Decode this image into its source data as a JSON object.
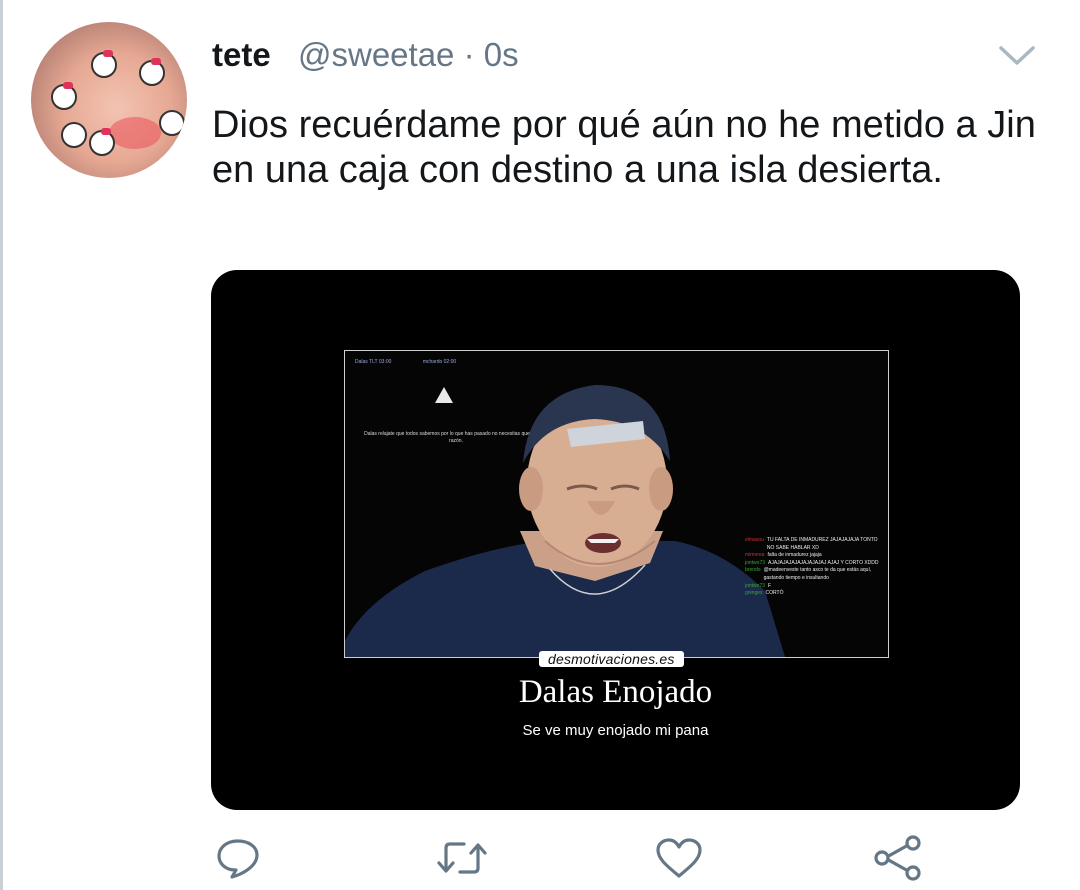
{
  "tweet": {
    "author_name": "tete",
    "handle_time": "@sweetae · 0s",
    "text": "Dios recuérdame por qué aún no he metido a Jin en una caja con destino a una isla desierta."
  },
  "media": {
    "scoreboard": [
      "Dalas TLT 03:00",
      "mchardo 02:00"
    ],
    "overlay_message": "Dalas relajate que todos sabemos por lo que has pasado no necesitas que él entre razón.",
    "chat": [
      {
        "user": "elmasnu",
        "text": "TU FALTA DE INMADUREZ JAJAJAJAJA TONTO NO SABE HABLAR XD"
      },
      {
        "user": "mimorea",
        "text": "falta de inmadurez jajaja"
      },
      {
        "user": "jontwo73",
        "text": "AJAJAJAJAJAJAJAJAJAJ AJAJ Y CORTO XDDD"
      },
      {
        "user": "brendo",
        "text": "@madeenveste tanto asco te da que estás aquí, gastando tiempo e insultando"
      },
      {
        "user": "jontwo73",
        "text": "F"
      },
      {
        "user": "goinges",
        "text": "CORTÓ"
      }
    ],
    "watermark": "desmotivaciones.es",
    "title": "Dalas Enojado",
    "subtitle": "Se ve muy enojado mi pana"
  },
  "actions": {
    "reply": "reply-icon",
    "retweet": "retweet-icon",
    "like": "heart-icon",
    "share": "share-icon"
  },
  "colors": {
    "text_primary": "#14171a",
    "text_secondary": "#657786",
    "icon": "#657786",
    "media_bg": "#000000"
  }
}
